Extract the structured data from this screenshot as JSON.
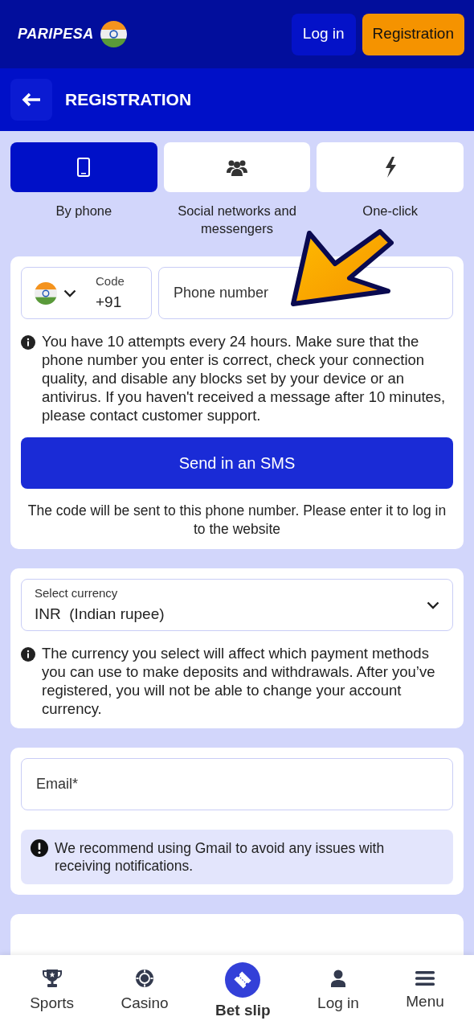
{
  "header": {
    "logo": "PARIPESA",
    "login": "Log in",
    "register": "Registration"
  },
  "page": {
    "title": "REGISTRATION"
  },
  "methods": [
    {
      "label": "By phone",
      "selected": true
    },
    {
      "label": "Social networks and messengers",
      "selected": false
    },
    {
      "label": "One-click",
      "selected": false
    }
  ],
  "phone": {
    "code_label": "Code",
    "code": "+91",
    "placeholder": "Phone number",
    "info": "You have 10 attempts every 24 hours. Make sure that the phone number you enter is correct, check your connection quality, and disable any blocks set by your device or an antivirus. If you haven't received a message after 10 minutes, please contact customer support.",
    "button": "Send in an SMS",
    "note": "The code will be sent to this phone number. Please enter it to log in to the website"
  },
  "currency": {
    "label": "Select currency",
    "value": "INR  (Indian rupee)",
    "info": "The currency you select will affect which payment methods you can use to make deposits and withdrawals. After you’ve registered, you will not be able to change your account currency."
  },
  "email": {
    "placeholder": "Email*",
    "notice": "We recommend using Gmail to avoid any issues with receiving notifications."
  },
  "bottom_nav": [
    {
      "label": "Sports",
      "selected": false
    },
    {
      "label": "Casino",
      "selected": false
    },
    {
      "label": "Bet slip",
      "selected": true
    },
    {
      "label": "Log in",
      "selected": false
    },
    {
      "label": "Menu",
      "selected": false
    }
  ]
}
